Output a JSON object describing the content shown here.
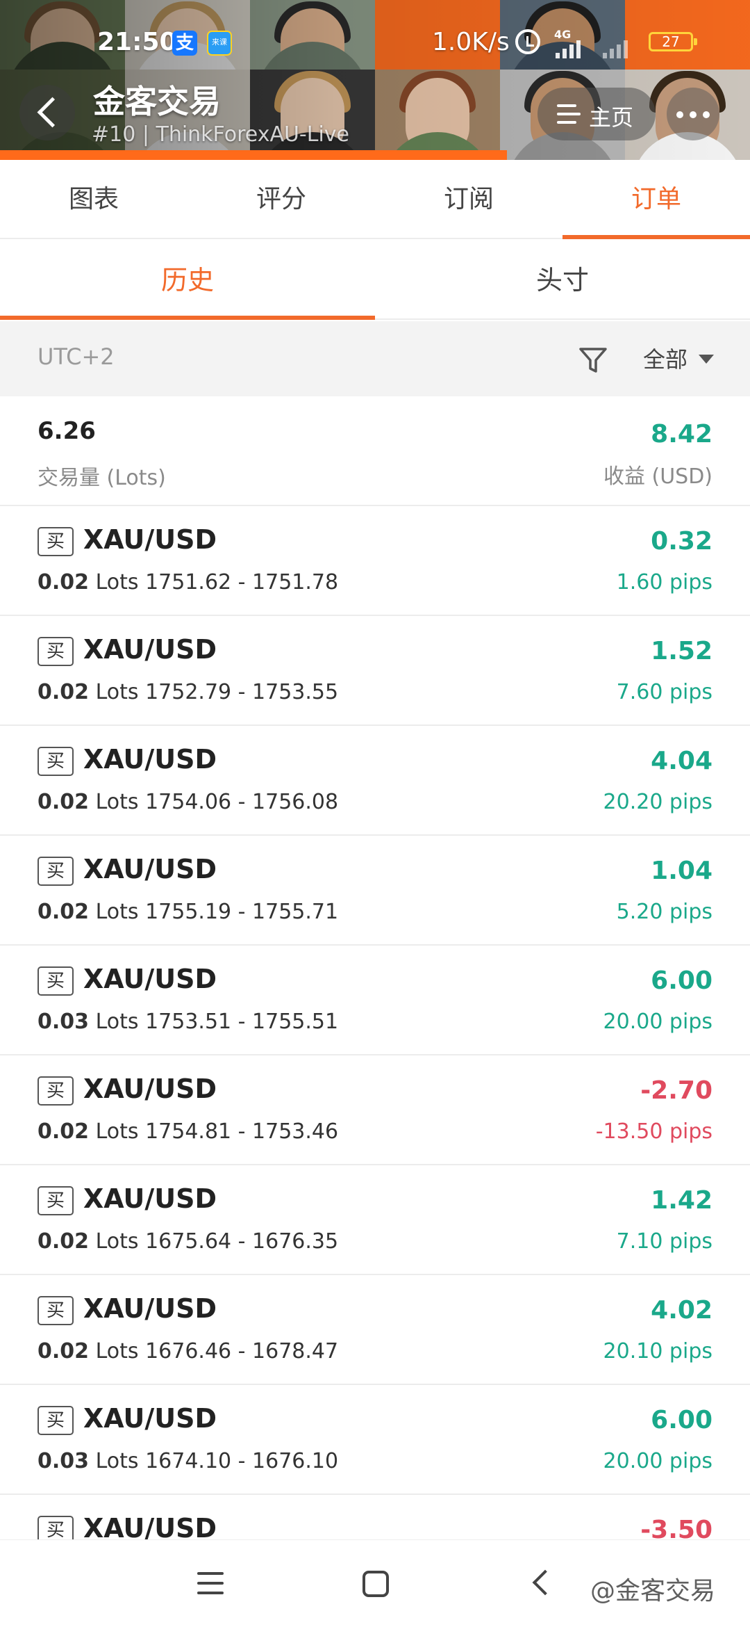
{
  "status_bar": {
    "time": "21:50",
    "app_icon_1": "支",
    "app_icon_2": "来课",
    "net_speed": "1.0K/s",
    "network": "4G",
    "battery": "27"
  },
  "header": {
    "title": "金客交易",
    "subtitle": "#10 | ThinkForexAU-Live",
    "home_label": "主页",
    "accent_color": "#ff6d1f"
  },
  "main_tabs": [
    {
      "label": "图表",
      "active": false
    },
    {
      "label": "评分",
      "active": false
    },
    {
      "label": "订阅",
      "active": false
    },
    {
      "label": "订单",
      "active": true
    }
  ],
  "sub_tabs": [
    {
      "label": "历史",
      "active": true
    },
    {
      "label": "头寸",
      "active": false
    }
  ],
  "filter": {
    "timezone": "UTC+2",
    "scope": "全部"
  },
  "summary": {
    "lots": "6.26",
    "lots_label": "交易量 (Lots)",
    "profit": "8.42",
    "profit_label": "收益 (USD)"
  },
  "colors": {
    "positive": "#1aa88a",
    "negative": "#e04a5e",
    "active_tab": "#f26a2b"
  },
  "orders": [
    {
      "side": "买",
      "symbol": "XAU/USD",
      "lots": "0.02",
      "lots_unit": "Lots",
      "range": "1751.62 - 1751.78",
      "profit": "0.32",
      "pips": "1.60 pips",
      "positive": true
    },
    {
      "side": "买",
      "symbol": "XAU/USD",
      "lots": "0.02",
      "lots_unit": "Lots",
      "range": "1752.79 - 1753.55",
      "profit": "1.52",
      "pips": "7.60 pips",
      "positive": true
    },
    {
      "side": "买",
      "symbol": "XAU/USD",
      "lots": "0.02",
      "lots_unit": "Lots",
      "range": "1754.06 - 1756.08",
      "profit": "4.04",
      "pips": "20.20 pips",
      "positive": true
    },
    {
      "side": "买",
      "symbol": "XAU/USD",
      "lots": "0.02",
      "lots_unit": "Lots",
      "range": "1755.19 - 1755.71",
      "profit": "1.04",
      "pips": "5.20 pips",
      "positive": true
    },
    {
      "side": "买",
      "symbol": "XAU/USD",
      "lots": "0.03",
      "lots_unit": "Lots",
      "range": "1753.51 - 1755.51",
      "profit": "6.00",
      "pips": "20.00 pips",
      "positive": true
    },
    {
      "side": "买",
      "symbol": "XAU/USD",
      "lots": "0.02",
      "lots_unit": "Lots",
      "range": "1754.81 - 1753.46",
      "profit": "-2.70",
      "pips": "-13.50 pips",
      "positive": false
    },
    {
      "side": "买",
      "symbol": "XAU/USD",
      "lots": "0.02",
      "lots_unit": "Lots",
      "range": "1675.64 - 1676.35",
      "profit": "1.42",
      "pips": "7.10 pips",
      "positive": true
    },
    {
      "side": "买",
      "symbol": "XAU/USD",
      "lots": "0.02",
      "lots_unit": "Lots",
      "range": "1676.46 - 1678.47",
      "profit": "4.02",
      "pips": "20.10 pips",
      "positive": true
    },
    {
      "side": "买",
      "symbol": "XAU/USD",
      "lots": "0.03",
      "lots_unit": "Lots",
      "range": "1674.10 - 1676.10",
      "profit": "6.00",
      "pips": "20.00 pips",
      "positive": true
    },
    {
      "side": "买",
      "symbol": "XAU/USD",
      "lots": "",
      "lots_unit": "",
      "range": "",
      "profit": "-3.50",
      "pips": "",
      "positive": false
    }
  ],
  "watermark": "@金客交易"
}
